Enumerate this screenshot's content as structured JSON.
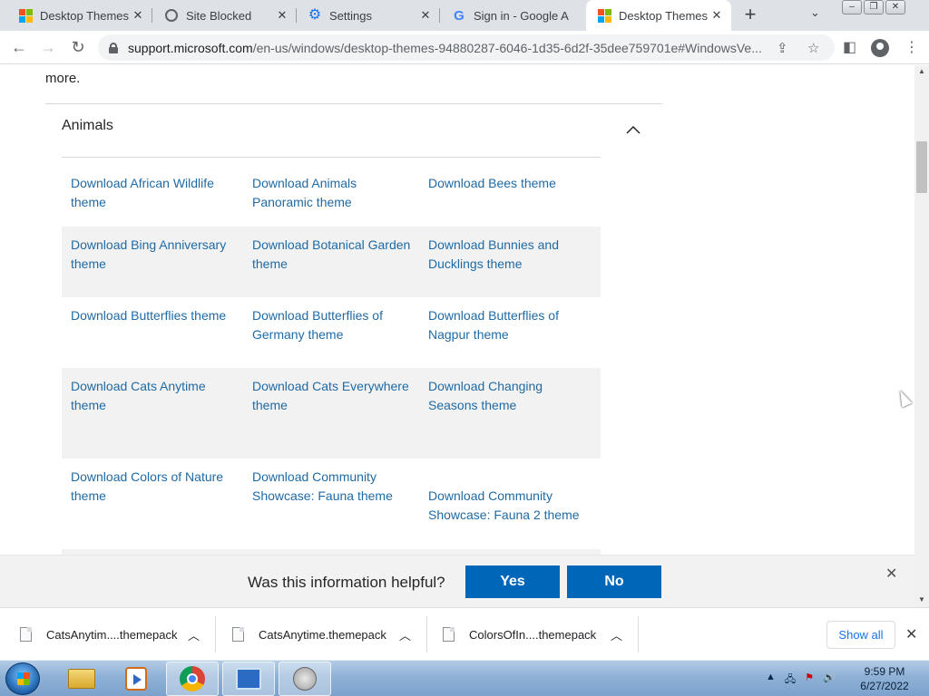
{
  "browser": {
    "tabs": [
      {
        "title": "Desktop Themes",
        "icon": "microsoft-logo-icon"
      },
      {
        "title": "Site Blocked",
        "icon": "globe-icon"
      },
      {
        "title": "Settings",
        "icon": "gear-icon"
      },
      {
        "title": "Sign in - Google A",
        "icon": "google-icon"
      },
      {
        "title": "Desktop Themes",
        "icon": "microsoft-logo-icon",
        "active": true
      }
    ],
    "url_host": "support.microsoft.com",
    "url_path": "/en-us/windows/desktop-themes-94880287-6046-1d35-6d2f-35dee759701e#WindowsVe..."
  },
  "page": {
    "intro_tail": "more.",
    "section_title": "Animals",
    "rows": [
      {
        "shaded": false,
        "items": [
          "Download African Wildlife theme",
          "Download Animals Panoramic theme",
          "Download Bees theme"
        ]
      },
      {
        "shaded": true,
        "items": [
          "Download Bing Anniversary theme",
          "Download Botanical Garden theme",
          "Download Bunnies and Ducklings theme"
        ]
      },
      {
        "shaded": false,
        "items": [
          "Download Butterflies theme",
          "Download Butterflies of Germany theme",
          "Download Butterflies of Nagpur theme"
        ]
      },
      {
        "shaded": true,
        "items": [
          "Download Cats Anytime theme",
          "Download Cats Everywhere theme",
          "Download Changing Seasons theme"
        ]
      },
      {
        "shaded": false,
        "items": [
          "Download Colors of Nature theme",
          "Download Community Showcase: Fauna theme",
          "Download Community Showcase: Fauna 2 theme"
        ]
      }
    ]
  },
  "feedback": {
    "question": "Was this information helpful?",
    "yes_label": "Yes",
    "no_label": "No"
  },
  "downloads": {
    "items": [
      "CatsAnytim....themepack",
      "CatsAnytime.themepack",
      "ColorsOfIn....themepack"
    ],
    "show_all_label": "Show all"
  },
  "taskbar": {
    "time": "9:59 PM",
    "date": "6/27/2022",
    "apps": [
      "windows-explorer-icon",
      "media-player-icon",
      "chrome-icon",
      "control-panel-icon",
      "speaker-app-icon"
    ]
  },
  "colors": {
    "link": "#1f6aa5",
    "primary_button": "#0067b8",
    "row_shade": "#f2f2f2"
  }
}
